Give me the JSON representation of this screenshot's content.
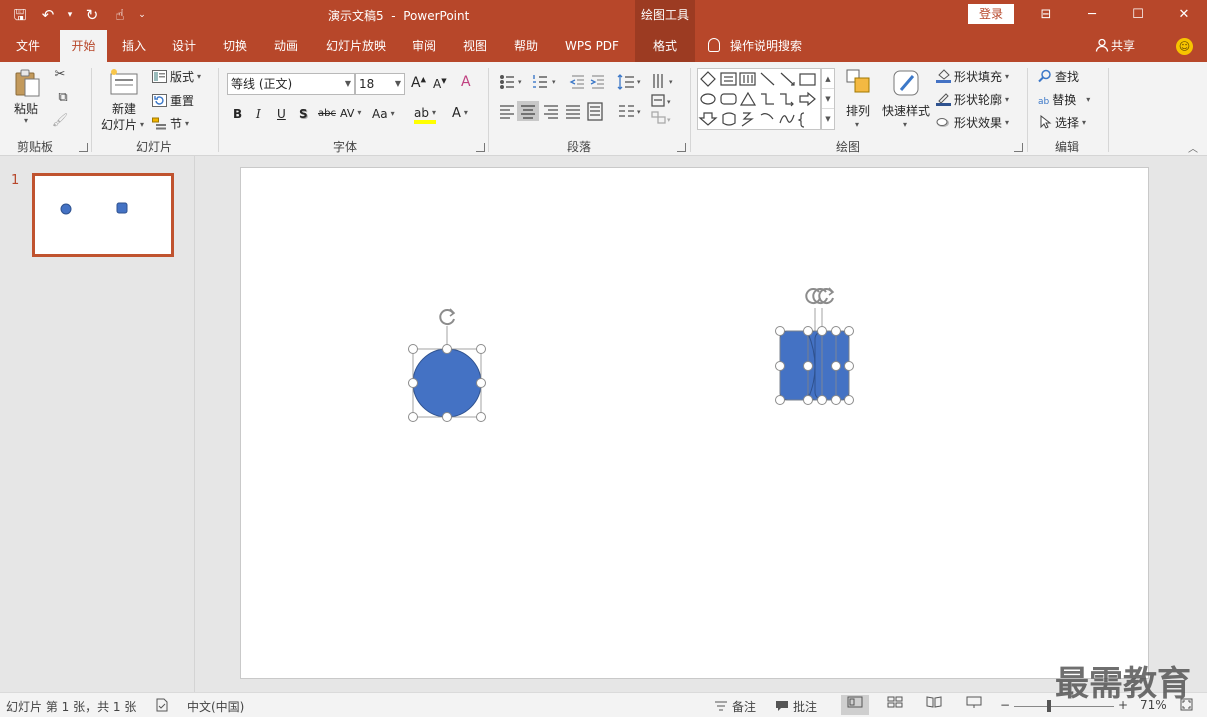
{
  "app": {
    "title": "演示文稿5  -  PowerPoint",
    "context_tools": "绘图工具",
    "login": "登录",
    "window_controls": {
      "restore_ribbon": "⊟",
      "minimize": "─",
      "maximize": "☐",
      "close": "✕"
    },
    "quick_access": {
      "save": "🖫",
      "undo": "↶",
      "undo_drop": "▾",
      "redo": "↻",
      "touch": "☝",
      "customize": "⌄"
    }
  },
  "tabs": {
    "file": "文件",
    "home": "开始",
    "insert": "插入",
    "design": "设计",
    "transitions": "切换",
    "animations": "动画",
    "slideshow": "幻灯片放映",
    "review": "审阅",
    "view": "视图",
    "help": "帮助",
    "wps_pdf": "WPS PDF",
    "format": "格式",
    "tell_me": "操作说明搜索",
    "share": "共享",
    "smiley": "☺"
  },
  "ribbon": {
    "clipboard": {
      "paste": "粘贴",
      "label": "剪贴板",
      "cut_icon": "✂",
      "copy_icon": "⧉",
      "painter_icon": "🖌"
    },
    "slides": {
      "new_slide_line1": "新建",
      "new_slide_line2": "幻灯片",
      "layout": "版式",
      "reset": "重置",
      "section": "节",
      "label": "幻灯片"
    },
    "font": {
      "family": "等线 (正文)",
      "size": "18",
      "grow": "A",
      "shrink": "A",
      "clear": "A",
      "bold": "B",
      "italic": "I",
      "underline": "U",
      "shadow": "S",
      "strike": "abc",
      "spacing": "AV",
      "case": "Aa",
      "highlight": "ab",
      "color": "A",
      "label": "字体"
    },
    "paragraph": {
      "label": "段落"
    },
    "drawing": {
      "arrange": "排列",
      "quick_styles": "快速样式",
      "fill": "形状填充",
      "outline": "形状轮廓",
      "effects": "形状效果",
      "label": "绘图"
    },
    "editing": {
      "find": "查找",
      "replace": "替换",
      "select": "选择",
      "label": "编辑"
    }
  },
  "thumbnails": {
    "slide_number": "1"
  },
  "statusbar": {
    "slide_info": "幻灯片 第 1 张，共 1 张",
    "language": "中文(中国)",
    "notes": "备注",
    "comments": "批注",
    "zoom": "71%",
    "zoom_minus": "−",
    "zoom_plus": "+"
  },
  "watermark": "最需教育",
  "colors": {
    "accent": "#b7472a",
    "shape_fill": "#4472c4",
    "shape_stroke": "#2f528f"
  }
}
